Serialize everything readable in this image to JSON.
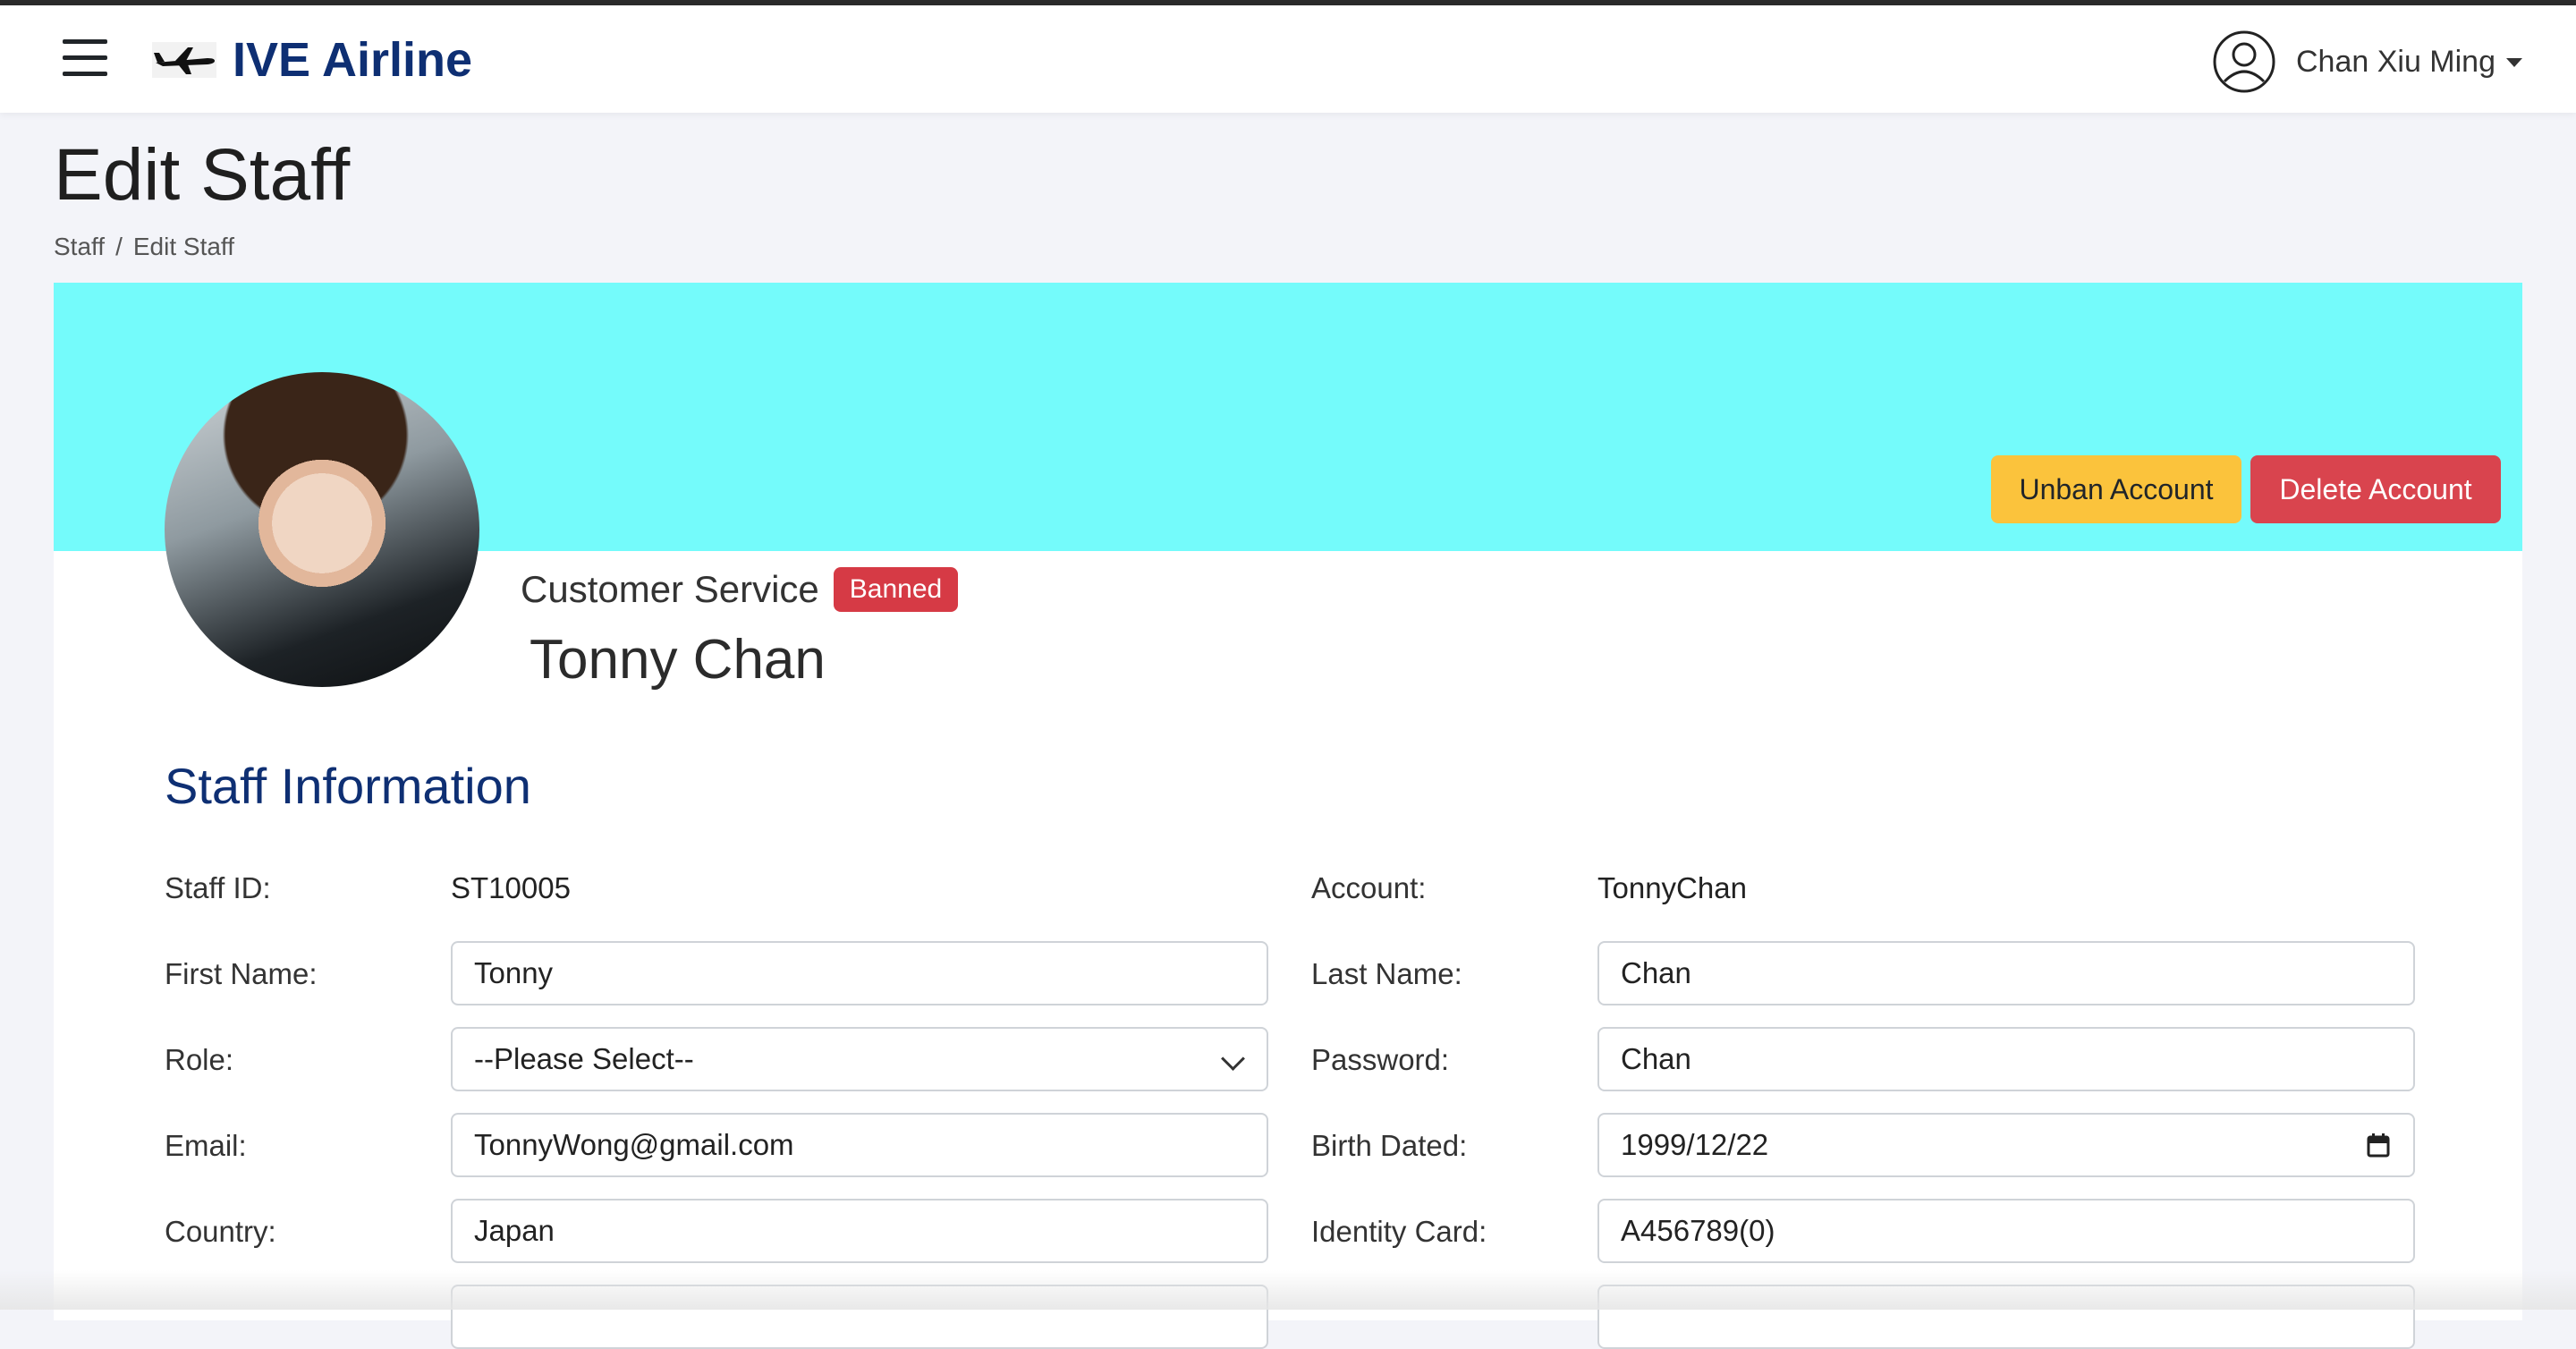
{
  "app": {
    "brand": "IVE Airline"
  },
  "user": {
    "name": "Chan Xiu Ming"
  },
  "page": {
    "title": "Edit Staff"
  },
  "breadcrumb": {
    "items": [
      "Staff",
      "Edit Staff"
    ],
    "separator": "/"
  },
  "actions": {
    "unban": "Unban Account",
    "delete": "Delete Account"
  },
  "profile": {
    "role": "Customer Service",
    "status": "Banned",
    "name": "Tonny Chan"
  },
  "section": {
    "title": "Staff Information"
  },
  "fields": {
    "staff_id": {
      "label": "Staff ID:",
      "value": "ST10005"
    },
    "account": {
      "label": "Account:",
      "value": "TonnyChan"
    },
    "first_name": {
      "label": "First Name:",
      "value": "Tonny"
    },
    "last_name": {
      "label": "Last Name:",
      "value": "Chan"
    },
    "role": {
      "label": "Role:",
      "value": "--Please Select--"
    },
    "password": {
      "label": "Password:",
      "value": "Chan"
    },
    "email": {
      "label": "Email:",
      "value": "TonnyWong@gmail.com"
    },
    "birth_date": {
      "label": "Birth Dated:",
      "value": "1999/12/22"
    },
    "country": {
      "label": "Country:",
      "value": "Japan"
    },
    "identity_card": {
      "label": "Identity Card:",
      "value": "A456789(0)"
    }
  },
  "colors": {
    "brand": "#0e2f73",
    "banner": "#74fbfb",
    "unban_button": "#fbc33c",
    "delete_button": "#d9444e",
    "badge": "#d63a45"
  },
  "icons": {
    "menu": "hamburger-icon",
    "brand": "airplane-icon",
    "user": "user-circle-icon",
    "dropdown": "chevron-down-icon",
    "calendar": "calendar-icon"
  }
}
